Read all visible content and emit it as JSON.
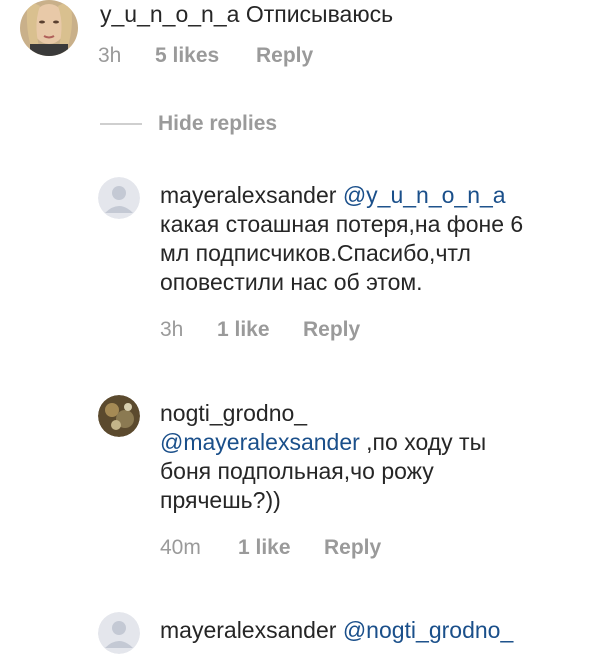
{
  "comments": [
    {
      "username": "y_u_n_o_n_a",
      "text": "Отписываюсь",
      "time": "3h",
      "likes": "5 likes",
      "reply": "Reply"
    },
    {
      "username": "mayeralexsander",
      "mention": "@y_u_n_o_n_a",
      "lines": [
        "какая стоашная потеря,на фоне 6",
        "мл подписчиков.Спасибо,чтл",
        "оповестили нас об этом."
      ],
      "time": "3h",
      "likes": "1 like",
      "reply": "Reply"
    },
    {
      "username": "nogti_grodno_",
      "mention": "@mayeralexsander",
      "first_line_rest": ",по ходу ты",
      "lines": [
        "боня подпольная,чо рожу",
        "прячешь?))"
      ],
      "time": "40m",
      "likes": "1 like",
      "reply": "Reply"
    },
    {
      "username": "mayeralexsander",
      "mention": "@nogti_grodno_"
    }
  ],
  "hide_replies_label": "Hide replies"
}
